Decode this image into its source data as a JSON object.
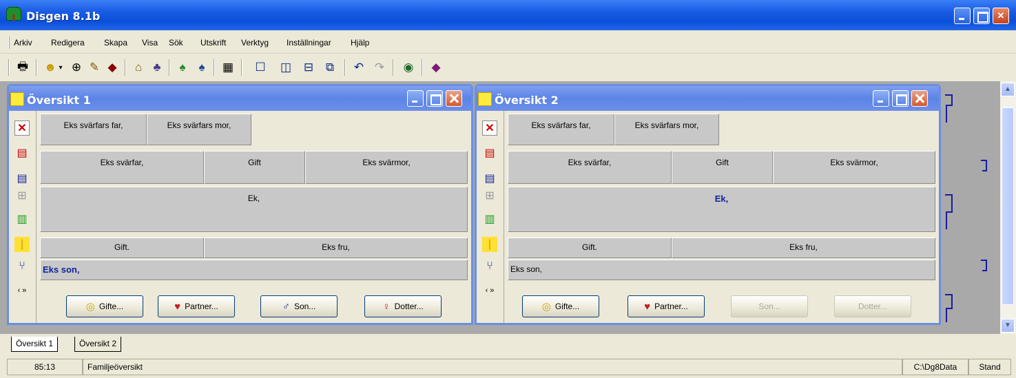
{
  "app": {
    "title": "Disgen 8.1b"
  },
  "menu": [
    "Arkiv",
    "Redigera",
    "Skapa",
    "Visa",
    "Sök",
    "Utskrift",
    "Verktyg",
    "Inställningar",
    "Hjälp"
  ],
  "toolbar": {
    "icons": [
      "print-icon",
      "person-icon",
      "dropdown-arrow-icon",
      "binoculars-icon",
      "notes-icon",
      "book-icon",
      "home-icon",
      "family-icon",
      "tree-icon",
      "tree-blue-icon",
      "calendar-icon",
      "window-single-icon",
      "window-split-vertical-icon",
      "window-split-horizontal-icon",
      "window-cascade-icon",
      "undo-icon",
      "redo-icon",
      "globe-icon",
      "help-book-icon"
    ]
  },
  "windows": [
    {
      "title": "Översikt 1",
      "grandparents": [
        "Eks svärfars far,",
        "Eks svärfars mor,"
      ],
      "parents": {
        "father": "Eks svärfar,",
        "relation": "Gift",
        "mother": "Eks svärmor,"
      },
      "main": "Ek,",
      "spouse_row": {
        "relation": "Gift.",
        "spouse": "Eks fru,"
      },
      "child": "Eks son,",
      "buttons": {
        "marry": "Gifte...",
        "partner": "Partner...",
        "son": "Son...",
        "daughter": "Dotter..."
      }
    },
    {
      "title": "Översikt 2",
      "grandparents": [
        "Eks svärfars far,",
        "Eks svärfars mor,"
      ],
      "parents": {
        "father": "Eks svärfar,",
        "relation": "Gift",
        "mother": "Eks svärmor,"
      },
      "main": "Ek,",
      "spouse_row": {
        "relation": "Gift.",
        "spouse": "Eks fru,"
      },
      "child": "Eks son,",
      "buttons": {
        "marry": "Gifte...",
        "partner": "Partner...",
        "son": "Son...",
        "daughter": "Dotter..."
      }
    }
  ],
  "tabs": [
    "Översikt 1",
    "Översikt 2"
  ],
  "status": {
    "position": "85:13",
    "view": "Familjeöversikt",
    "path": "C:\\Dg8Data",
    "mode": "Stand"
  }
}
